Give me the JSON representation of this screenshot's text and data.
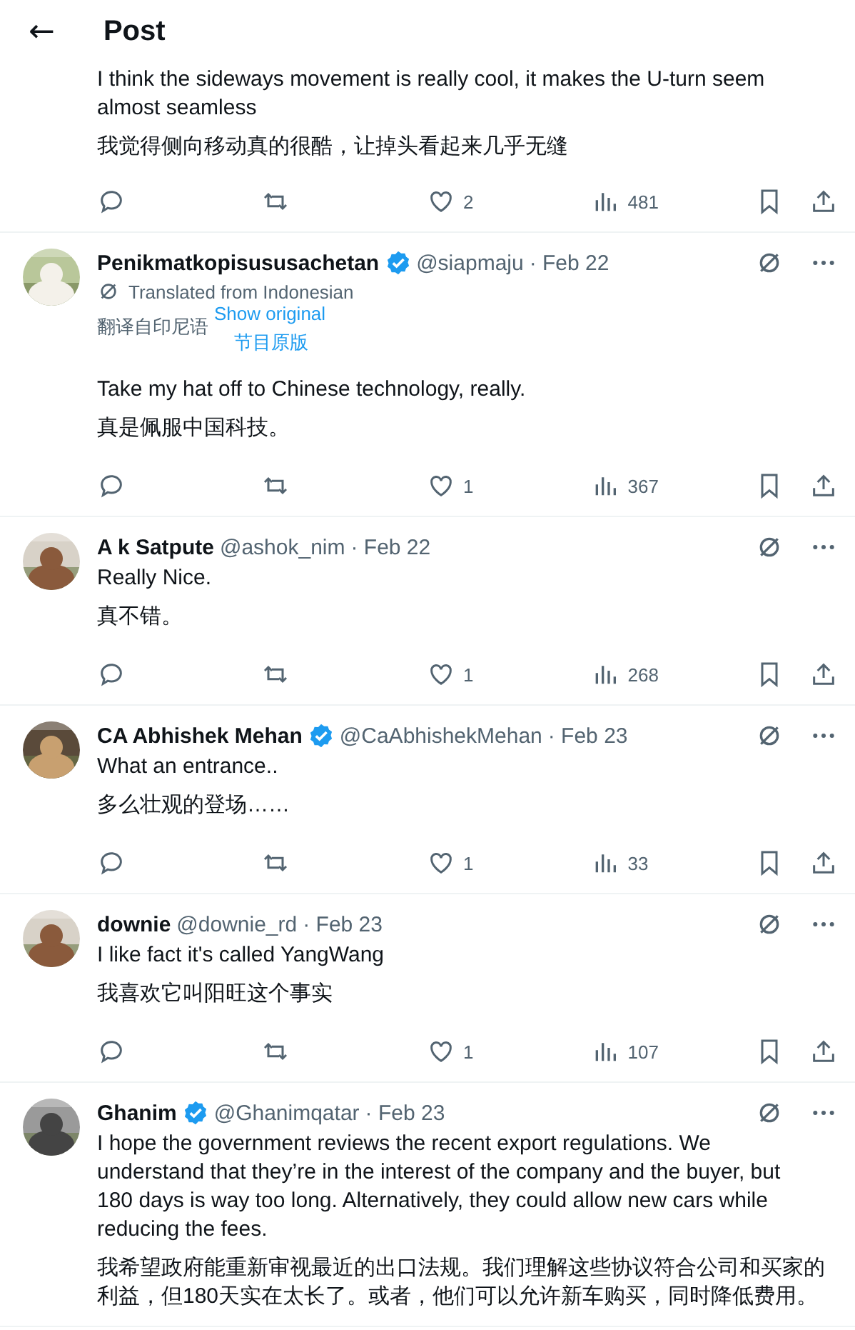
{
  "header": {
    "back": "←",
    "title": "Post"
  },
  "tweets": [
    {
      "text_en": "I think the sideways movement is really cool, it makes the U-turn seem almost seamless",
      "text_zh": "我觉得侧向移动真的很酷，让掉头看起来几乎无缝",
      "stats": {
        "likes": "2",
        "views": "481"
      }
    },
    {
      "author": "Penikmatkopisususachetan",
      "verified": true,
      "handle": "@siapmaju",
      "date": "· Feb 22",
      "translation": {
        "note": "Translated from Indonesian",
        "note_zh": "翻译自印尼语",
        "link": "Show original",
        "link_zh": "节目原版"
      },
      "text_en": "Take my hat off to Chinese technology, really.",
      "text_zh": "真是佩服中国科技。",
      "stats": {
        "likes": "1",
        "views": "367"
      }
    },
    {
      "author": "A k Satpute",
      "verified": false,
      "handle": "@ashok_nim",
      "date": "· Feb 22",
      "text_en": "Really Nice.",
      "text_zh": "真不错。",
      "stats": {
        "likes": "1",
        "views": "268"
      }
    },
    {
      "author": "CA Abhishek Mehan",
      "verified": true,
      "handle": "@CaAbhishekMehan",
      "date": "· Feb 23",
      "text_en": "What an entrance..",
      "text_zh": "多么壮观的登场……",
      "stats": {
        "likes": "1",
        "views": "33"
      }
    },
    {
      "author": "downie",
      "verified": false,
      "handle": "@downie_rd",
      "date": "· Feb 23",
      "text_en": "I like fact it's called YangWang",
      "text_zh": "我喜欢它叫阳旺这个事实",
      "stats": {
        "likes": "1",
        "views": "107"
      }
    },
    {
      "author": "Ghanim",
      "verified": true,
      "handle": "@Ghanimqatar",
      "date": "· Feb 23",
      "text_en": "I hope the government reviews the recent export regulations. We understand that they’re in the interest of the company and the buyer, but 180 days is way too long. Alternatively, they could allow new cars while reducing the fees.",
      "text_zh": "我希望政府能重新审视最近的出口法规。我们理解这些协议符合公司和买家的利益，但180天实在太长了。或者，他们可以允许新车购买，同时降低费用。"
    }
  ]
}
